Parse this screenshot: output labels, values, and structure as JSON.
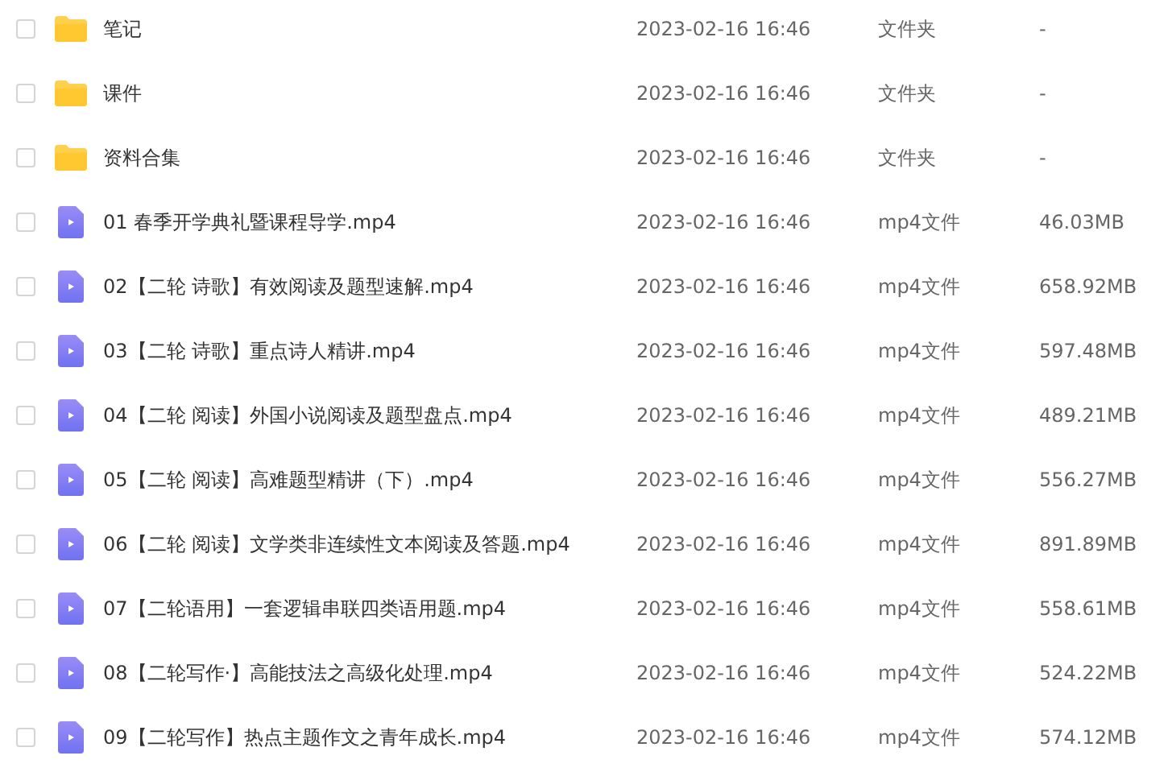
{
  "files": [
    {
      "kind": "folder",
      "checked": false,
      "name": "笔记",
      "modified": "2023-02-16 16:46",
      "type": "文件夹",
      "size": "-"
    },
    {
      "kind": "folder",
      "checked": false,
      "name": "课件",
      "modified": "2023-02-16 16:46",
      "type": "文件夹",
      "size": "-"
    },
    {
      "kind": "folder",
      "checked": false,
      "name": "资料合集",
      "modified": "2023-02-16 16:46",
      "type": "文件夹",
      "size": "-"
    },
    {
      "kind": "video",
      "checked": false,
      "name": "01 春季开学典礼暨课程导学.mp4",
      "modified": "2023-02-16 16:46",
      "type": "mp4文件",
      "size": "46.03MB"
    },
    {
      "kind": "video",
      "checked": false,
      "name": "02【二轮 诗歌】有效阅读及题型速解.mp4",
      "modified": "2023-02-16 16:46",
      "type": "mp4文件",
      "size": "658.92MB"
    },
    {
      "kind": "video",
      "checked": false,
      "name": "03【二轮 诗歌】重点诗人精讲.mp4",
      "modified": "2023-02-16 16:46",
      "type": "mp4文件",
      "size": "597.48MB"
    },
    {
      "kind": "video",
      "checked": false,
      "name": "04【二轮 阅读】外国小说阅读及题型盘点.mp4",
      "modified": "2023-02-16 16:46",
      "type": "mp4文件",
      "size": "489.21MB"
    },
    {
      "kind": "video",
      "checked": false,
      "name": "05【二轮 阅读】高难题型精讲（下）.mp4",
      "modified": "2023-02-16 16:46",
      "type": "mp4文件",
      "size": "556.27MB"
    },
    {
      "kind": "video",
      "checked": false,
      "name": "06【二轮 阅读】文学类非连续性文本阅读及答题.mp4",
      "modified": "2023-02-16 16:46",
      "type": "mp4文件",
      "size": "891.89MB"
    },
    {
      "kind": "video",
      "checked": false,
      "name": "07【二轮语用】一套逻辑串联四类语用题.mp4",
      "modified": "2023-02-16 16:46",
      "type": "mp4文件",
      "size": "558.61MB"
    },
    {
      "kind": "video",
      "checked": false,
      "name": "08【二轮写作·】高能技法之高级化处理.mp4",
      "modified": "2023-02-16 16:46",
      "type": "mp4文件",
      "size": "524.22MB"
    },
    {
      "kind": "video",
      "checked": false,
      "name": "09【二轮写作】热点主题作文之青年成长.mp4",
      "modified": "2023-02-16 16:46",
      "type": "mp4文件",
      "size": "574.12MB"
    }
  ]
}
